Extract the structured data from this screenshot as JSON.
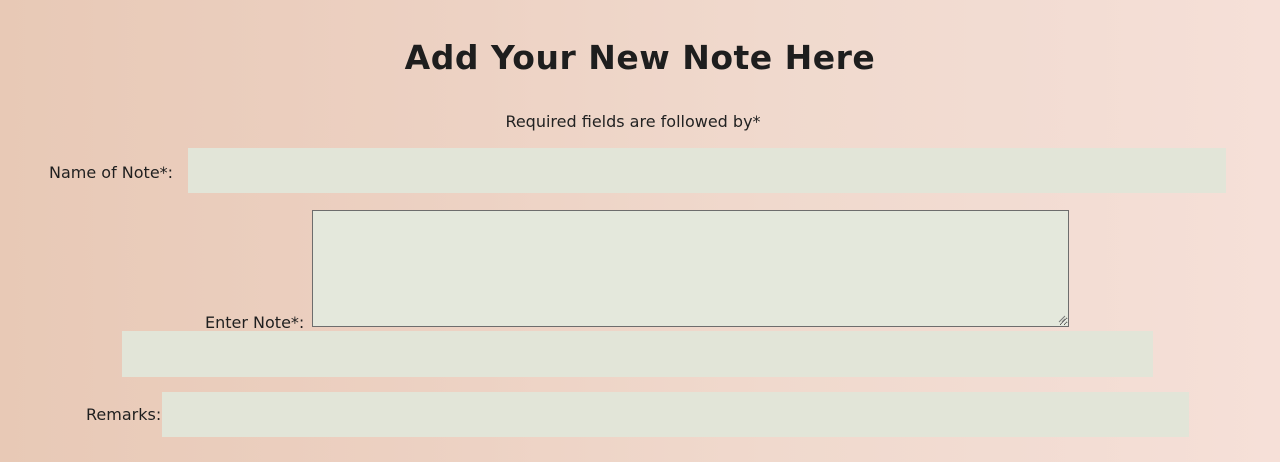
{
  "form": {
    "title": "Add Your New Note Here",
    "required_note": "Required fields are followed by*",
    "fields": {
      "name_of_note": {
        "label": "Name of Note*:",
        "value": "",
        "placeholder": ""
      },
      "enter_note": {
        "label": "Enter Note*:",
        "value": "",
        "placeholder": ""
      },
      "extra_field": {
        "value": "",
        "placeholder": ""
      },
      "remarks": {
        "label": "Remarks:",
        "value": "",
        "placeholder": ""
      }
    }
  },
  "colors": {
    "field_background": "#e2e5d8",
    "page_background": "#ecd0c1",
    "textarea_border": "#6d6d6d"
  },
  "icons": {
    "textarea_resize": "resize-grip-icon"
  }
}
